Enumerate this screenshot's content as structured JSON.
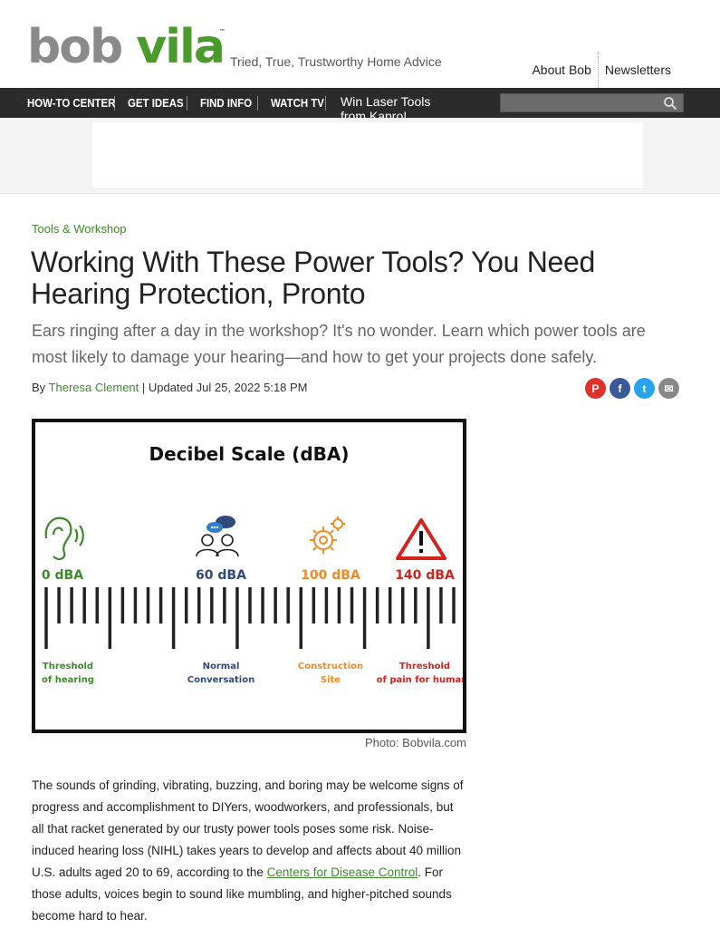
{
  "header": {
    "logo_bob": "bob",
    "logo_vila": "vila",
    "logo_tm": "™",
    "tagline": "Tried, True, Trustworthy Home Advice",
    "links": [
      "About Bob",
      "Newsletters"
    ]
  },
  "nav": {
    "items": [
      "HOW-TO CENTER",
      "GET IDEAS",
      "FIND INFO",
      "WATCH TV"
    ],
    "promo": "Win Laser Tools from Kapro!",
    "search_icon": "search-icon"
  },
  "article": {
    "category": "Tools & Workshop",
    "headline": "Working With These Power Tools? You Need Hearing Protection, Pronto",
    "dek": "Ears ringing after a day in the workshop? It's no wonder. Learn which power tools are most likely to damage your hearing—and how to get your projects done safely.",
    "byline_prefix": "By",
    "author": "Theresa Clement",
    "updated": "| Updated Jul 25, 2022 5:18 PM",
    "share": [
      {
        "icon": "pinterest-icon",
        "glyph": "P",
        "color": "#e0312b"
      },
      {
        "icon": "facebook-icon",
        "glyph": "f",
        "color": "#3b5998"
      },
      {
        "icon": "twitter-icon",
        "glyph": "t",
        "color": "#2aa3ef"
      },
      {
        "icon": "email-icon",
        "glyph": "✉",
        "color": "#888888"
      }
    ]
  },
  "figure": {
    "title": "Decibel Scale (dBA)",
    "levels": [
      {
        "value": "0 dBA",
        "label1": "Threshold",
        "label2": "of hearing",
        "color": "#3c8a2a",
        "icon": "ear-icon"
      },
      {
        "value": "60 dBA",
        "label1": "Normal",
        "label2": "Conversation",
        "color": "#2e4a7a",
        "icon": "conversation-icon"
      },
      {
        "value": "100 dBA",
        "label1": "Construction",
        "label2": "Site",
        "color": "#f08a24",
        "icon": "gear-icon"
      },
      {
        "value": "140 dBA",
        "label1": "Threshold",
        "label2": "of pain for humans",
        "color": "#d4231f",
        "icon": "warning-icon"
      }
    ],
    "caption": "Photo: Bobvila.com"
  },
  "body": {
    "p1_before": "The sounds of grinding, vibrating, buzzing, and boring may be welcome signs of progress and accomplishment to DIYers, woodworkers, and professionals, but all that racket generated by our trusty power tools poses some risk. Noise-induced hearing loss (NIHL) takes years to develop and affects about 40 million U.S. adults aged 20 to 69, according to the ",
    "p1_link": "Centers for Disease Control",
    "p1_after": ". For those adults, voices begin to sound like mumbling, and higher-pitched sounds become hard to hear."
  }
}
